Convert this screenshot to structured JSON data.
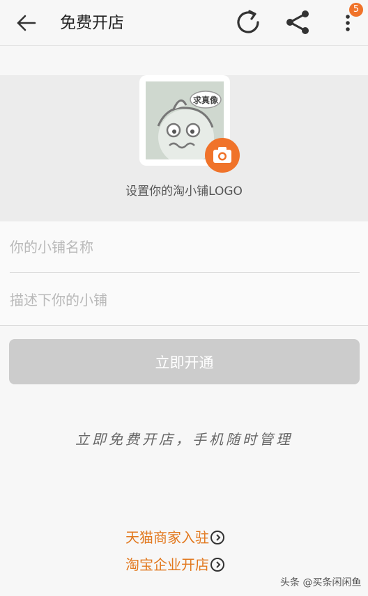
{
  "header": {
    "title": "免费开店",
    "badge_count": "5",
    "icons": [
      "back-arrow-icon",
      "refresh-icon",
      "share-icon",
      "more-vertical-icon"
    ]
  },
  "logo": {
    "sticker_text": "求真像",
    "label": "设置你的淘小铺LOGO",
    "camera_icon": "camera-icon"
  },
  "form": {
    "name_placeholder": "你的小铺名称",
    "desc_placeholder": "描述下你的小铺"
  },
  "open_button_label": "立即开通",
  "slogan": "立即免费开店，手机随时管理",
  "links": {
    "tmall": "天猫商家入驻",
    "taobao": "淘宝企业开店"
  },
  "watermark": "头条 @买条闲闲鱼",
  "colors": {
    "accent": "#f0732a",
    "link": "#e2791f",
    "disabled_button": "#cccccc"
  }
}
